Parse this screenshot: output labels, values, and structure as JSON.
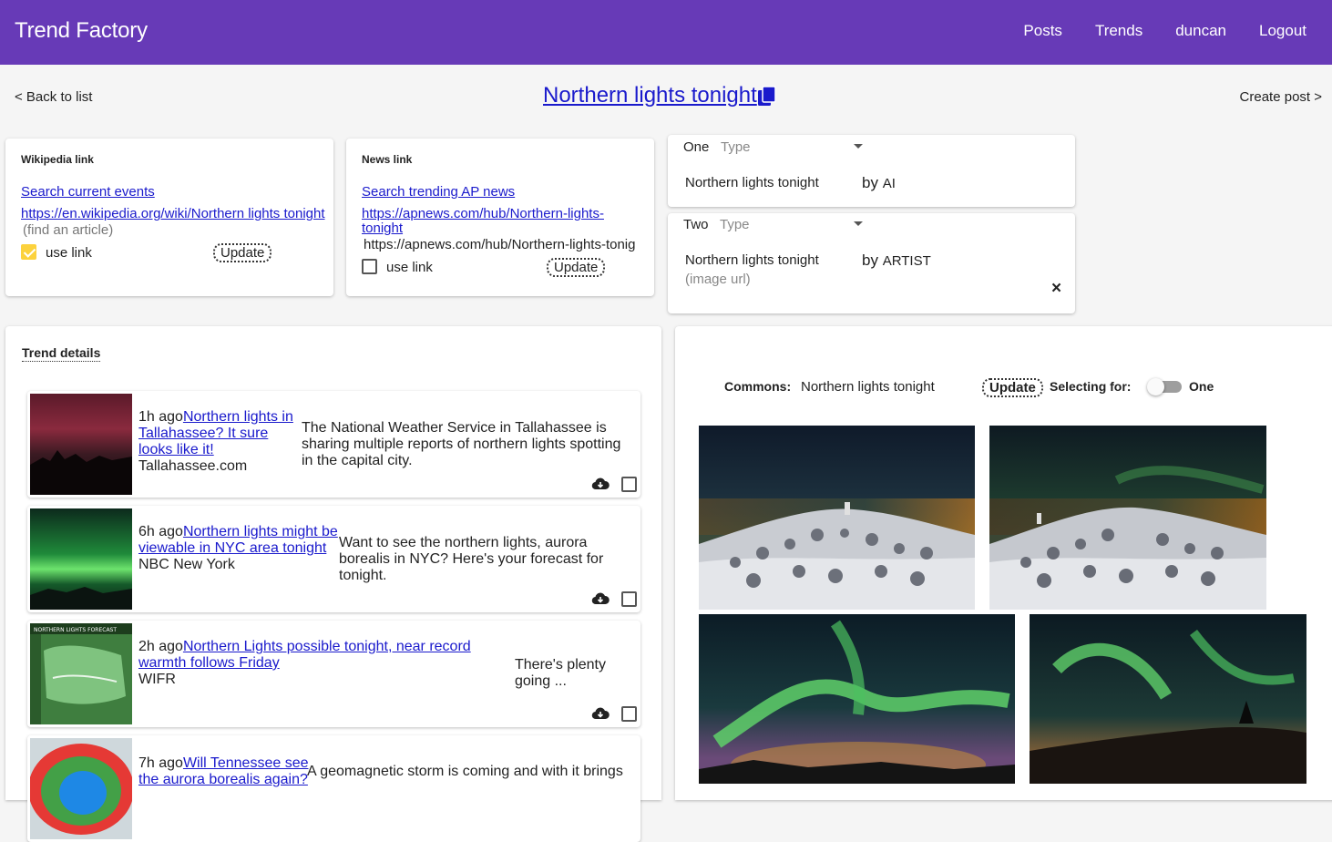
{
  "app": {
    "title": "Trend Factory",
    "nav": [
      "Posts",
      "Trends",
      "duncan",
      "Logout"
    ]
  },
  "subheader": {
    "back": "< Back to list",
    "title": "Northern lights tonight",
    "create": "Create post >"
  },
  "wiki": {
    "heading": "Wikipedia link",
    "search": "Search current events",
    "url": "https://en.wikipedia.org/wiki/Northern lights tonight",
    "hint": "(find an article)",
    "use_link": "use link",
    "use_link_checked": true,
    "update": "Update"
  },
  "news": {
    "heading": "News link",
    "search": "Search trending AP news",
    "url_line1": "https://apnews.com/hub/Northern-lights-",
    "url_line2": "tonight",
    "input_value": "https://apnews.com/hub/Northern-lights-tonig",
    "use_link": "use link",
    "use_link_checked": false,
    "update": "Update"
  },
  "assets": [
    {
      "slot": "One",
      "type_placeholder": "Type",
      "text": "Northern lights tonight",
      "by": "by",
      "author": "AI",
      "sub": ""
    },
    {
      "slot": "Two",
      "type_placeholder": "Type",
      "text": "Northern lights tonight",
      "by": "by",
      "author": "ARTIST",
      "sub": "(image url)",
      "close": "×"
    }
  ],
  "trend_details": {
    "heading": "Trend details",
    "items": [
      {
        "age": "1h ago",
        "link1": "Northern lights in",
        "link2": "Tallahassee? It sure",
        "link3": "looks like it!",
        "source": "Tallahassee.com",
        "desc1": "The National Weather Service in Tallahassee is",
        "desc2": "sharing multiple reports of northern lights spotting",
        "desc3": "in the capital city."
      },
      {
        "age": "6h ago",
        "link1": "Northern lights might be",
        "link2": "viewable in NYC area tonight",
        "link3": "",
        "source": "NBC New York",
        "desc1": "Want to see the northern lights, aurora",
        "desc2": "borealis in NYC? Here's your forecast for",
        "desc3": "tonight."
      },
      {
        "age": "2h ago",
        "link1": "Northern Lights possible tonight, near record",
        "link2": "warmth follows Friday",
        "link3": "",
        "source": "WIFR",
        "desc1": "There's plenty",
        "desc2": "going ...",
        "desc3": ""
      },
      {
        "age": "7h ago",
        "link1": "Will Tennessee see",
        "link2": "the aurora borealis again?",
        "link3": "",
        "source": "",
        "desc1": "A geomagnetic storm is coming and with it brings",
        "desc2": "",
        "desc3": ""
      }
    ],
    "thumb3_label": "NORTHERN LIGHTS FORECAST"
  },
  "commons": {
    "label": "Commons:",
    "query": "Northern lights tonight",
    "update": "Update",
    "selecting_label": "Selecting for:",
    "selecting_value": "One"
  },
  "colors": {
    "appbar": "#673ab7",
    "link": "#1a1acc",
    "checkbox_on": "#fcd23d"
  }
}
